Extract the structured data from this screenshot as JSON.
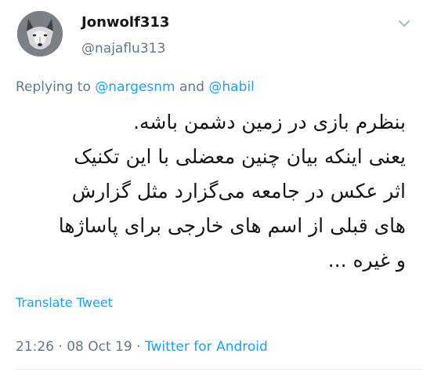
{
  "author": {
    "display_name": "Jonwolf313",
    "handle": "@najaflu313"
  },
  "reply": {
    "prefix": "Replying to ",
    "mention1": "@nargesnm",
    "conjunction": " and ",
    "mention2": "@habil"
  },
  "tweet": {
    "lines": [
      "بنظرم بازی در زمین دشمن باشه.",
      "یعنی اینکه بیان چنین معضلی با این تکنیک",
      "اثر عکس در جامعه می‌گزارد مثل گزارش",
      "های قبلی از اسم های خارجی برای پاساژها",
      "و غیره ..."
    ]
  },
  "translate_label": "Translate Tweet",
  "meta": {
    "time": "21:26",
    "separator": " · ",
    "date": "08 Oct 19",
    "separator2": " · ",
    "source": "Twitter for Android"
  },
  "colors": {
    "link": "#1da1f2",
    "secondary": "#657786",
    "text": "#14171a"
  },
  "icons": {
    "avatar": "wolf-avatar",
    "caret": "chevron-down-icon"
  }
}
